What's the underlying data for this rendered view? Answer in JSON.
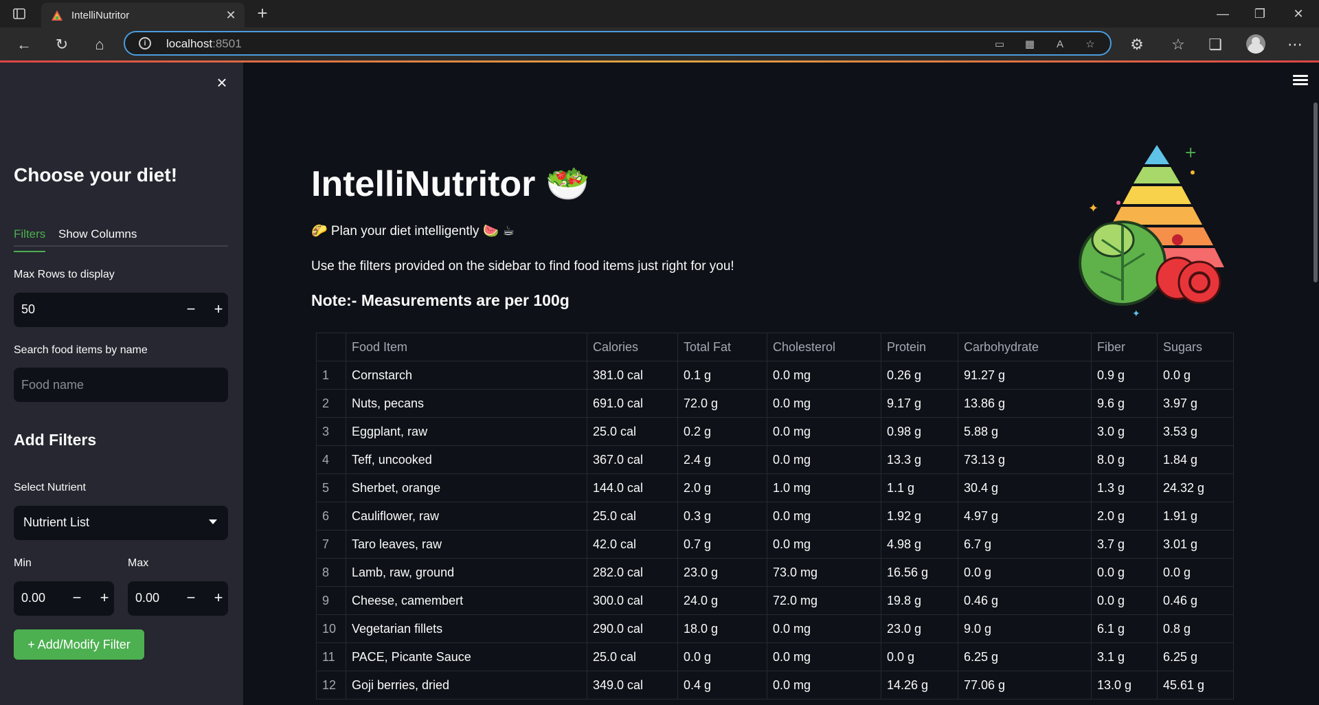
{
  "browser": {
    "tab_title": "IntelliNutritor",
    "url_host": "localhost",
    "url_port": ":8501"
  },
  "sidebar": {
    "heading": "Choose your diet!",
    "tabs": [
      "Filters",
      "Show Columns"
    ],
    "max_rows_label": "Max Rows to display",
    "max_rows_value": "50",
    "search_label": "Search food items by name",
    "search_placeholder": "Food name",
    "add_filters_heading": "Add Filters",
    "select_nutrient_label": "Select Nutrient",
    "nutrient_select_value": "Nutrient List",
    "min_label": "Min",
    "min_value": "0.00",
    "max_label": "Max",
    "max_value": "0.00",
    "add_filter_button": "+ Add/Modify Filter"
  },
  "main": {
    "title": "IntelliNutritor",
    "title_emoji": "🥗",
    "tagline": "🌮 Plan your diet intelligently 🍉 ☕",
    "instructions": "Use the filters provided on the sidebar to find food items just right for you!",
    "note": "Note:- Measurements are per 100g"
  },
  "table": {
    "columns": [
      "",
      "Food Item",
      "Calories",
      "Total Fat",
      "Cholesterol",
      "Protein",
      "Carbohydrate",
      "Fiber",
      "Sugars"
    ],
    "rows": [
      [
        "1",
        "Cornstarch",
        "381.0 cal",
        "0.1 g",
        "0.0 mg",
        "0.26 g",
        "91.27 g",
        "0.9 g",
        "0.0 g"
      ],
      [
        "2",
        "Nuts, pecans",
        "691.0 cal",
        "72.0 g",
        "0.0 mg",
        "9.17 g",
        "13.86 g",
        "9.6 g",
        "3.97 g"
      ],
      [
        "3",
        "Eggplant, raw",
        "25.0 cal",
        "0.2 g",
        "0.0 mg",
        "0.98 g",
        "5.88 g",
        "3.0 g",
        "3.53 g"
      ],
      [
        "4",
        "Teff, uncooked",
        "367.0 cal",
        "2.4 g",
        "0.0 mg",
        "13.3 g",
        "73.13 g",
        "8.0 g",
        "1.84 g"
      ],
      [
        "5",
        "Sherbet, orange",
        "144.0 cal",
        "2.0 g",
        "1.0 mg",
        "1.1 g",
        "30.4 g",
        "1.3 g",
        "24.32 g"
      ],
      [
        "6",
        "Cauliflower, raw",
        "25.0 cal",
        "0.3 g",
        "0.0 mg",
        "1.92 g",
        "4.97 g",
        "2.0 g",
        "1.91 g"
      ],
      [
        "7",
        "Taro leaves, raw",
        "42.0 cal",
        "0.7 g",
        "0.0 mg",
        "4.98 g",
        "6.7 g",
        "3.7 g",
        "3.01 g"
      ],
      [
        "8",
        "Lamb, raw, ground",
        "282.0 cal",
        "23.0 g",
        "73.0 mg",
        "16.56 g",
        "0.0 g",
        "0.0 g",
        "0.0 g"
      ],
      [
        "9",
        "Cheese, camembert",
        "300.0 cal",
        "24.0 g",
        "72.0 mg",
        "19.8 g",
        "0.46 g",
        "0.0 g",
        "0.46 g"
      ],
      [
        "10",
        "Vegetarian fillets",
        "290.0 cal",
        "18.0 g",
        "0.0 mg",
        "23.0 g",
        "9.0 g",
        "6.1 g",
        "0.8 g"
      ],
      [
        "11",
        "PACE, Picante Sauce",
        "25.0 cal",
        "0.0 g",
        "0.0 mg",
        "0.0 g",
        "6.25 g",
        "3.1 g",
        "6.25 g"
      ],
      [
        "12",
        "Goji berries, dried",
        "349.0 cal",
        "0.4 g",
        "0.0 mg",
        "14.26 g",
        "77.06 g",
        "13.0 g",
        "45.61 g"
      ]
    ]
  },
  "colors": {
    "app_bg": "#0e1117",
    "sidebar_bg": "#262730",
    "accent_green": "#4caf50",
    "address_border": "#4a9de0"
  },
  "icons": {
    "sidebar_close": "close-icon",
    "main_menu": "hamburger-menu-icon",
    "illustration": "food-pyramid-icon"
  }
}
